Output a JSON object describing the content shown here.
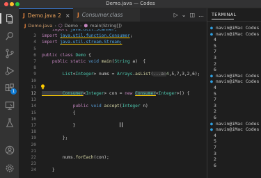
{
  "window": {
    "title": "Demo.java — Codes"
  },
  "activity": {
    "extensions_badge": "1"
  },
  "tabs": [
    {
      "label": "Demo.java",
      "errors": "2",
      "close": "×"
    },
    {
      "label": "Consumer.class"
    }
  ],
  "breadcrumb": {
    "file": "Demo.java",
    "cls": "Demo",
    "method": "main(String[])"
  },
  "editor": {
    "lines": [
      {
        "n": "",
        "tokens": [
          {
            "t": "    import ",
            "c": "kw"
          },
          {
            "t": "java.util.Scanner;",
            "c": "pk"
          }
        ]
      },
      {
        "n": "3",
        "tokens": [
          {
            "t": "import ",
            "c": "kw"
          },
          {
            "t": "java.util.function.Consumer",
            "c": "imp"
          },
          {
            "t": ";",
            "c": ""
          }
        ]
      },
      {
        "n": "4",
        "tokens": [
          {
            "t": "import ",
            "c": "kw"
          },
          {
            "t": "java.util.stream.Stream;",
            "c": "imp"
          }
        ]
      },
      {
        "n": "5",
        "tokens": []
      },
      {
        "n": "6",
        "tokens": [
          {
            "t": "public ",
            "c": "kw"
          },
          {
            "t": "class ",
            "c": "kw"
          },
          {
            "t": "Demo ",
            "c": "ty"
          },
          {
            "t": "{",
            "c": ""
          }
        ]
      },
      {
        "n": "7",
        "tokens": [
          {
            "t": "    public ",
            "c": "kw"
          },
          {
            "t": "static ",
            "c": "kw"
          },
          {
            "t": "void ",
            "c": "kw2"
          },
          {
            "t": "main",
            "c": "fn"
          },
          {
            "t": "(",
            "c": ""
          },
          {
            "t": "String",
            "c": "ty"
          },
          {
            "t": " a",
            "c": ""
          },
          {
            "t": ")  {",
            "c": ""
          }
        ]
      },
      {
        "n": "8",
        "tokens": []
      },
      {
        "n": "9",
        "tokens": [
          {
            "t": "        List",
            "c": "ty"
          },
          {
            "t": "<",
            "c": ""
          },
          {
            "t": "Integer",
            "c": "ty"
          },
          {
            "t": "> nums = ",
            "c": ""
          },
          {
            "t": "Arrays",
            "c": "ty"
          },
          {
            "t": ".",
            "c": ""
          },
          {
            "t": "asList",
            "c": "fn"
          },
          {
            "t": "(",
            "c": ""
          },
          {
            "t": "...a:",
            "c": "hint"
          },
          {
            "t": "4",
            "c": "nm"
          },
          {
            "t": ",5,7,3,2,6);",
            "c": ""
          }
        ]
      },
      {
        "n": "10",
        "tokens": []
      },
      {
        "n": "11",
        "tokens": []
      },
      {
        "n": "12",
        "tokens": [
          {
            "t": "        Consumer",
            "c": "hlty"
          },
          {
            "t": "<",
            "c": ""
          },
          {
            "t": "Integer",
            "c": "ty"
          },
          {
            "t": "> con = ",
            "c": ""
          },
          {
            "t": "new ",
            "c": "kw"
          },
          {
            "t": "Consumer",
            "c": "hlty"
          },
          {
            "t": "<",
            "c": ""
          },
          {
            "t": "Integer",
            "c": "ty"
          },
          {
            "t": ">() {",
            "c": ""
          }
        ]
      },
      {
        "n": "13",
        "tokens": []
      },
      {
        "n": "14",
        "tokens": [
          {
            "t": "            public ",
            "c": "kw"
          },
          {
            "t": "void ",
            "c": "kw2"
          },
          {
            "t": "accept",
            "c": "fn"
          },
          {
            "t": "(",
            "c": ""
          },
          {
            "t": "Integer",
            "c": "ty"
          },
          {
            "t": " n)",
            "c": ""
          }
        ]
      },
      {
        "n": "15",
        "tokens": [
          {
            "t": "            {",
            "c": ""
          }
        ]
      },
      {
        "n": "16",
        "tokens": []
      },
      {
        "n": "17",
        "tokens": [
          {
            "t": "            }",
            "c": ""
          }
        ]
      },
      {
        "n": "18",
        "tokens": []
      },
      {
        "n": "19",
        "tokens": [
          {
            "t": "        };",
            "c": ""
          }
        ]
      },
      {
        "n": "20",
        "tokens": []
      },
      {
        "n": "21",
        "tokens": []
      },
      {
        "n": "22",
        "tokens": [
          {
            "t": "        nums.",
            "c": ""
          },
          {
            "t": "forEach",
            "c": "fn"
          },
          {
            "t": "(con);",
            "c": ""
          }
        ]
      },
      {
        "n": "23",
        "tokens": []
      },
      {
        "n": "24",
        "tokens": [
          {
            "t": "    }",
            "c": ""
          }
        ]
      }
    ]
  },
  "terminal": {
    "title": "TERMINAL",
    "prompt": "navin@iMac Codes %",
    "output": [
      "4",
      "5",
      "7",
      "3",
      "2",
      "6"
    ]
  }
}
